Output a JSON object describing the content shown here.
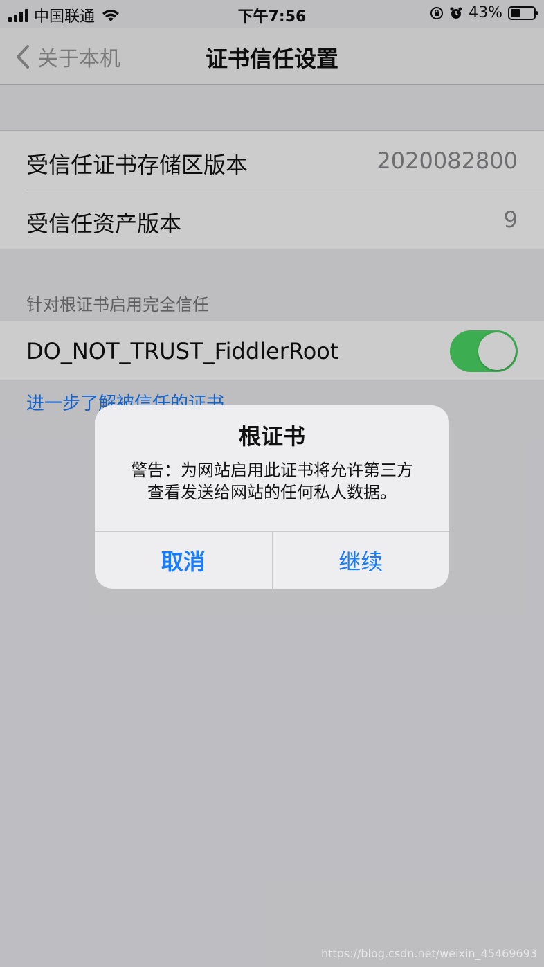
{
  "status_bar": {
    "carrier": "中国联通",
    "time": "下午7:56",
    "battery_percent": "43%",
    "battery_level": 0.43
  },
  "nav": {
    "back_label": "关于本机",
    "title": "证书信任设置"
  },
  "versions": [
    {
      "label": "受信任证书存储区版本",
      "value": "2020082800"
    },
    {
      "label": "受信任资产版本",
      "value": "9"
    }
  ],
  "trust_section": {
    "header": "针对根证书启用完全信任",
    "cert_name": "DO_NOT_TRUST_FiddlerRoot",
    "enabled": true,
    "learn_more": "进一步了解被信任的证书"
  },
  "alert": {
    "title": "根证书",
    "message_line1": "警告：为网站启用此证书将允许第三方",
    "message_line2": "查看发送给网站的任何私人数据。",
    "cancel_label": "取消",
    "continue_label": "继续"
  },
  "colors": {
    "accent": "#1a7cff",
    "toggle_on": "#4cd964"
  },
  "watermark": "https://blog.csdn.net/weixin_45469693"
}
